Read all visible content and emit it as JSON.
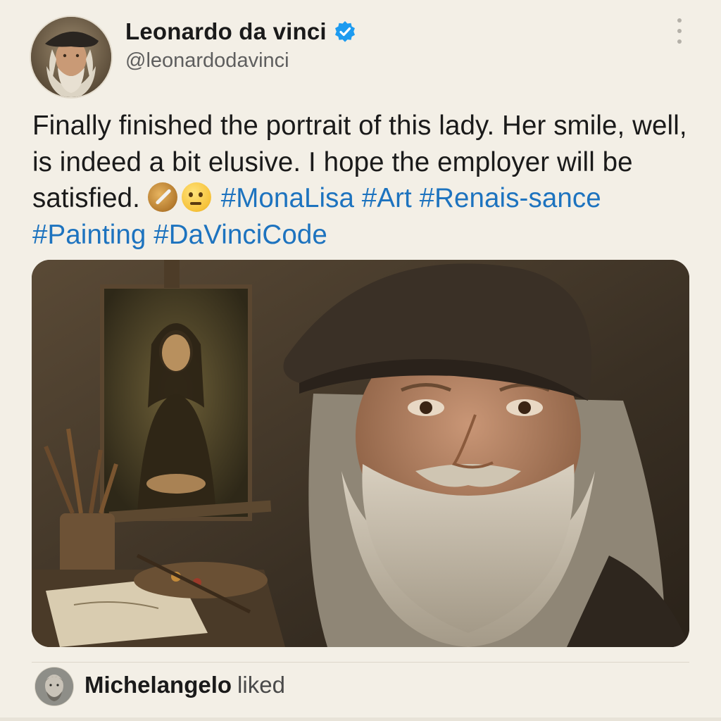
{
  "author": {
    "name": "Leonardo da vinci",
    "handle": "@leonardodavinci",
    "verified": true,
    "avatar_icon": "leonardo-portrait-avatar"
  },
  "post": {
    "text_main": "Finally finished the portrait of this lady. Her smile, well, is indeed a bit elusive. I hope the employer will be satisfied.",
    "emojis": [
      "artist-palette-emoji",
      "thinking-face-emoji"
    ],
    "hashtags": [
      "#MonaLisa",
      "#Art",
      "#Renais-sance",
      "#Painting",
      "#DaVinciCode"
    ],
    "image_subject": "Portrait photo of an elderly bearded man in a dark beret beside an easel with a painting of a woman"
  },
  "activity": {
    "liker_name": "Michelangelo",
    "action": "liked",
    "liker_avatar_icon": "michelangelo-avatar"
  },
  "colors": {
    "background": "#f3efe6",
    "hashtag": "#1d73bf",
    "verified_badge": "#1d9bf0"
  }
}
